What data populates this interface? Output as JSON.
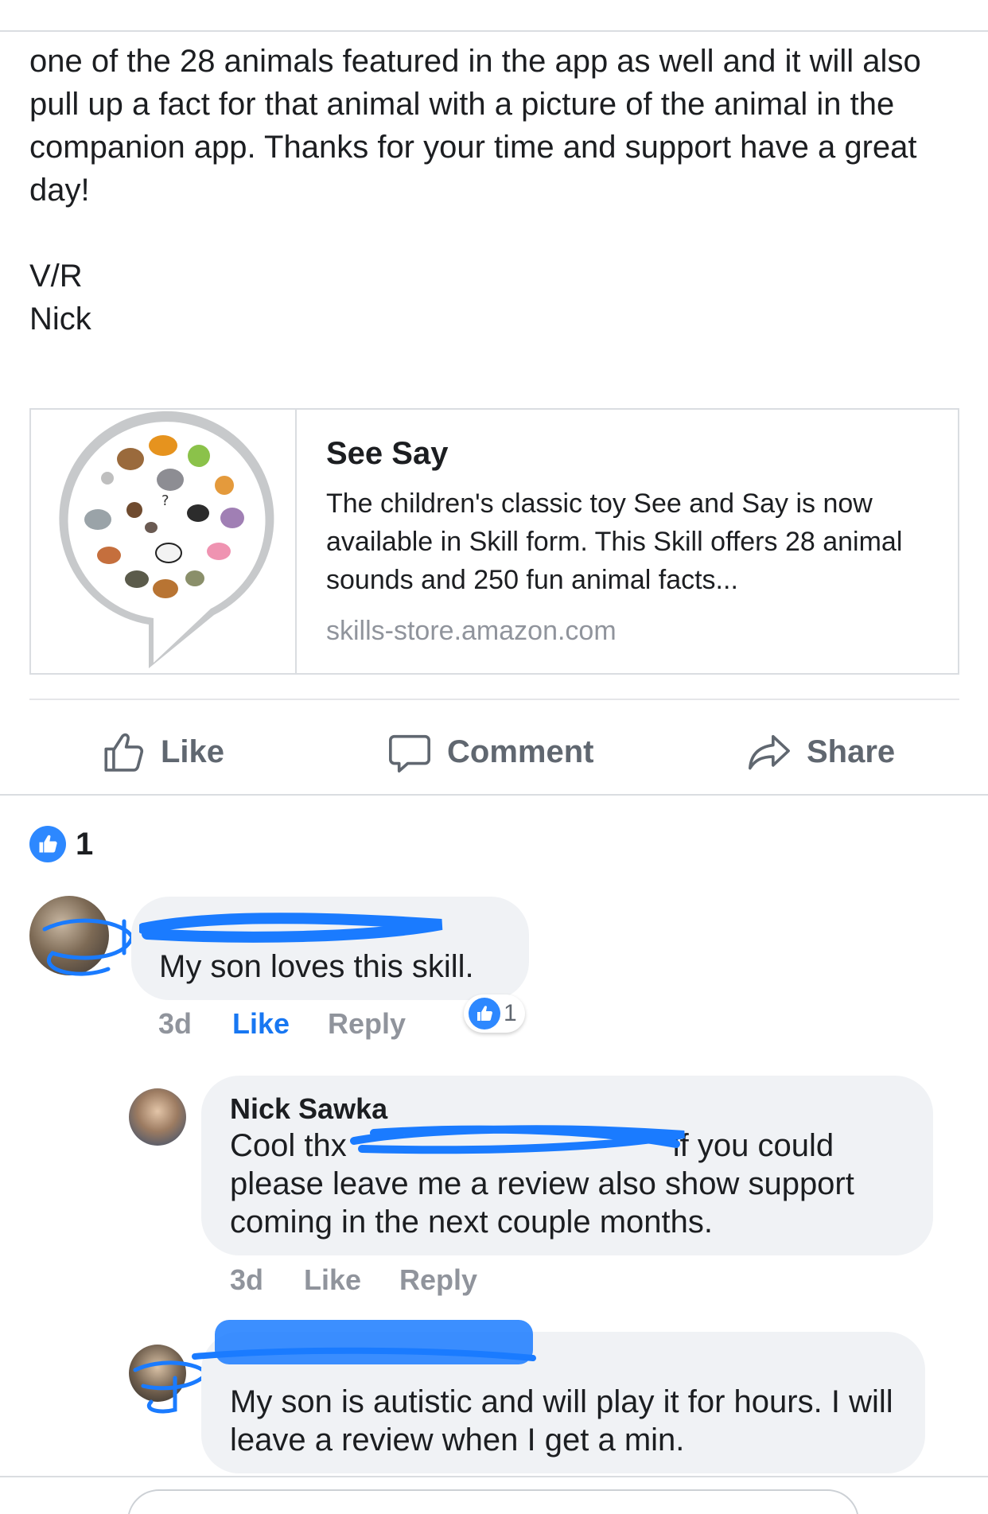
{
  "post": {
    "cut_line": "  ",
    "body": "one of the 28 animals featured in the app as well and it will also pull up a fact for that animal with a picture of the animal in the companion app. Thanks for your time and support have a great day!",
    "signoff": "V/R",
    "signature": "Nick"
  },
  "link_card": {
    "title": "See Say",
    "description": "The children's classic toy See and Say is now available in Skill form. This Skill offers 28 animal sounds and 250 fun animal facts...",
    "domain": "skills-store.amazon.com",
    "thumbnail_icon": "alexa-skill-animal-wheel",
    "center_mark": "?"
  },
  "actions": {
    "like": "Like",
    "comment": "Comment",
    "share": "Share"
  },
  "reactions": {
    "count": "1"
  },
  "comments": [
    {
      "author": "",
      "text": "My son loves this skill.",
      "time": "3d",
      "like": "Like",
      "reply": "Reply",
      "reaction_count": "1"
    },
    {
      "author": "Nick Sawka",
      "text_line1": "Cool thx",
      "text_line1_tail": "if you could",
      "text_rest": "please leave me a review also show support coming in the next couple months.",
      "time": "3d",
      "like": "Like",
      "reply": "Reply"
    },
    {
      "author": "",
      "text": "My son is autistic and will play it for hours. I will leave a review when I get a min."
    }
  ],
  "colors": {
    "accent": "#1877f2",
    "like_badge": "#2d88ff",
    "bubble": "#f0f2f5",
    "muted": "#90949c",
    "redaction": "#1a7bff"
  }
}
